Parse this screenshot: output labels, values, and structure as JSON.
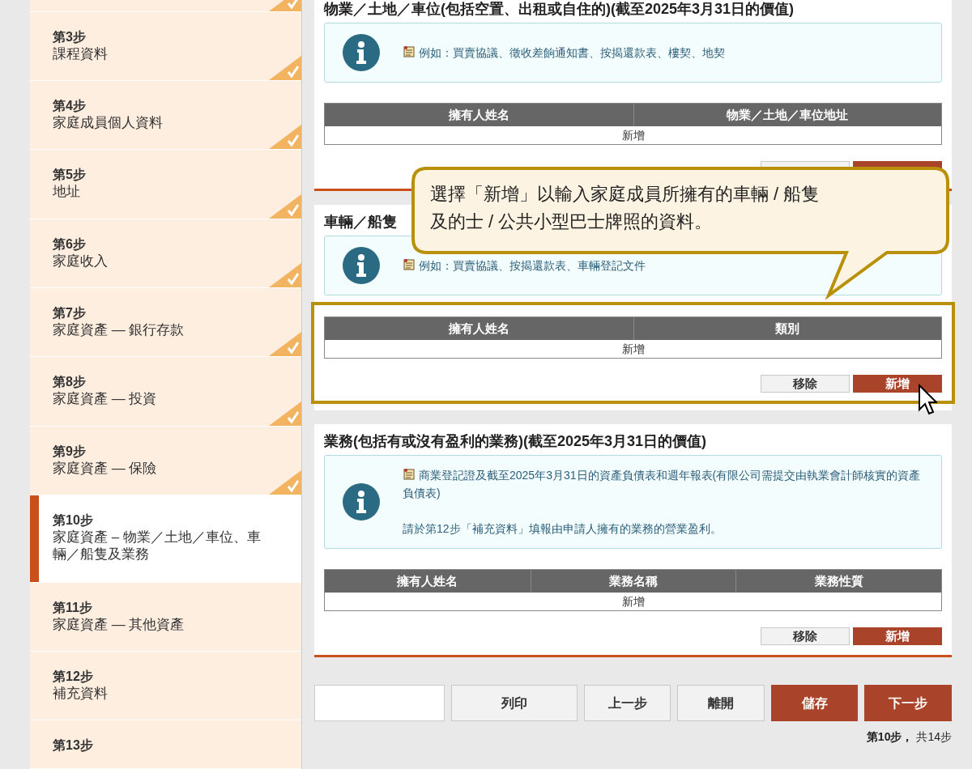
{
  "sidebar": {
    "items": [
      {
        "completed": true,
        "selected": false
      },
      {
        "step": "第3步",
        "title": "課程資料",
        "completed": true,
        "selected": false
      },
      {
        "step": "第4步",
        "title": "家庭成員個人資料",
        "completed": true,
        "selected": false
      },
      {
        "step": "第5步",
        "title": "地址",
        "completed": true,
        "selected": false
      },
      {
        "step": "第6步",
        "title": "家庭收入",
        "completed": true,
        "selected": false
      },
      {
        "step": "第7步",
        "title": "家庭資產 — 銀行存款",
        "completed": true,
        "selected": false
      },
      {
        "step": "第8步",
        "title": "家庭資產 — 投資",
        "completed": true,
        "selected": false
      },
      {
        "step": "第9步",
        "title": "家庭資產 — 保險",
        "completed": true,
        "selected": false
      },
      {
        "step": "第10步",
        "title": "家庭資產 – 物業／土地／車位、車輛／船隻及業務",
        "completed": false,
        "selected": true
      },
      {
        "step": "第11步",
        "title": "家庭資產 — 其他資產",
        "completed": false,
        "selected": false
      },
      {
        "step": "第12步",
        "title": "補充資料",
        "completed": false,
        "selected": false
      },
      {
        "step": "第13步",
        "completed": false,
        "selected": false
      }
    ]
  },
  "sections": [
    {
      "title": "物業／土地／車位(包括空置、出租或自住的)(截至2025年3月31日的價值)",
      "highlighted": false,
      "notes": [
        {
          "text": "例如：買賣協議、徵收差餉通知書、按揭還款表、樓契、地契",
          "icon": true
        }
      ],
      "columns": [
        "擁有人姓名",
        "物業／土地／車位地址"
      ],
      "empty_row": "新增",
      "buttons": [
        {
          "kind": "secondary"
        },
        {
          "kind": "primary"
        }
      ]
    },
    {
      "title": "車輛／船隻",
      "highlighted": true,
      "notes": [
        {
          "text": "例如：買賣協議、按揭還款表、車輛登記文件",
          "icon": true
        }
      ],
      "columns": [
        "擁有人姓名",
        "類別"
      ],
      "empty_row": "新增",
      "buttons": [
        {
          "label": "移除",
          "kind": "secondary"
        },
        {
          "label": "新增",
          "kind": "primary"
        }
      ]
    },
    {
      "title": "業務(包括有或沒有盈利的業務)(截至2025年3月31日的價值)",
      "highlighted": false,
      "notes": [
        {
          "text": "商業登記證及截至2025年3月31日的資產負債表和週年報表(有限公司需提交由執業會計師核實的資產負債表)",
          "icon": true
        },
        {
          "text": "請於第12步「補充資料」填報由申請人擁有的業務的營業盈利。",
          "icon": false
        }
      ],
      "columns": [
        "擁有人姓名",
        "業務名稱",
        "業務性質"
      ],
      "empty_row": "新增",
      "buttons": [
        {
          "label": "移除",
          "kind": "secondary"
        },
        {
          "label": "新增",
          "kind": "primary"
        }
      ]
    }
  ],
  "callout": {
    "lines": [
      "選擇「新增」以輸入家庭成員所擁有的車輛 / 船隻",
      "及的士 / 公共小型巴士牌照的資料。"
    ]
  },
  "footer_buttons": [
    {
      "label": "列印",
      "kind": "secondary"
    },
    {
      "label": "上一步",
      "kind": "secondary"
    },
    {
      "label": "離開",
      "kind": "secondary"
    },
    {
      "label": "儲存",
      "kind": "primary"
    },
    {
      "label": "下一步",
      "kind": "primary"
    }
  ],
  "step_indicator": {
    "current": "第10步，",
    "total": "共14步"
  }
}
